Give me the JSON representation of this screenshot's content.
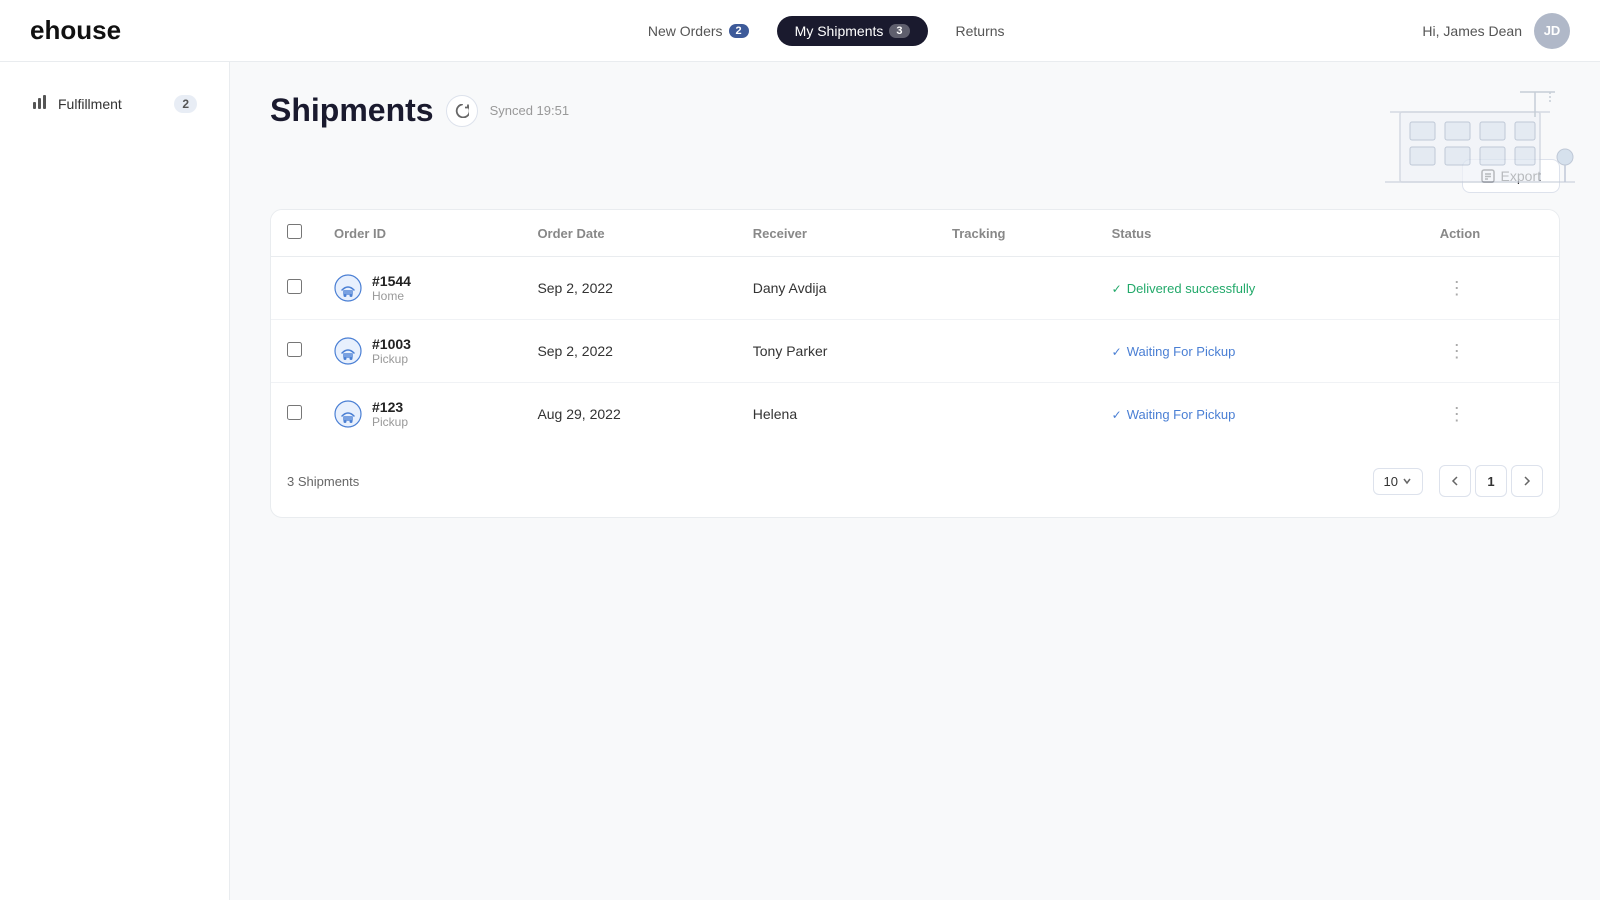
{
  "logo": "ehouse",
  "nav": {
    "items": [
      {
        "label": "New Orders",
        "count": "2",
        "active": false
      },
      {
        "label": "My Shipments",
        "count": "3",
        "active": true
      },
      {
        "label": "Returns",
        "count": null,
        "active": false
      }
    ],
    "greeting": "Hi, James Dean",
    "avatar_initials": "JD"
  },
  "sidebar": {
    "items": [
      {
        "label": "Fulfillment",
        "badge": "2"
      }
    ]
  },
  "page": {
    "title": "Shipments",
    "sync_label": "Synced 19:51",
    "export_label": "Export"
  },
  "table": {
    "columns": [
      "Order ID",
      "Order Date",
      "Receiver",
      "Tracking",
      "Status",
      "Action"
    ],
    "rows": [
      {
        "id": "#1544",
        "type": "Home",
        "date": "Sep 2, 2022",
        "receiver": "Dany Avdija",
        "tracking": "",
        "status": "Delivered successfully",
        "status_class": "delivered"
      },
      {
        "id": "#1003",
        "type": "Pickup",
        "date": "Sep 2, 2022",
        "receiver": "Tony Parker",
        "tracking": "",
        "status": "Waiting For Pickup",
        "status_class": "waiting"
      },
      {
        "id": "#123",
        "type": "Pickup",
        "date": "Aug 29, 2022",
        "receiver": "Helena",
        "tracking": "",
        "status": "Waiting For Pickup",
        "status_class": "waiting"
      }
    ]
  },
  "pagination": {
    "total_label": "3 Shipments",
    "per_page": "10",
    "current_page": "1"
  }
}
